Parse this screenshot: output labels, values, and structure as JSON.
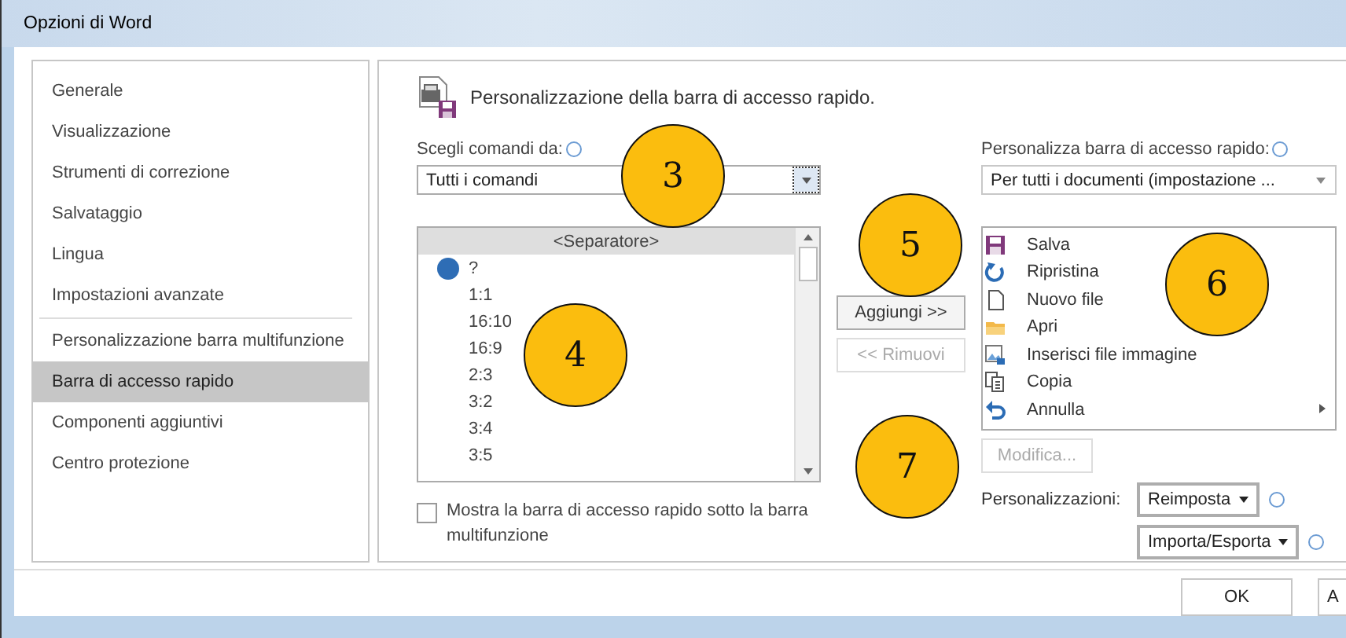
{
  "window": {
    "title": "Opzioni di Word"
  },
  "sidebar": {
    "items": [
      {
        "label": "Generale",
        "selected": false
      },
      {
        "label": "Visualizzazione",
        "selected": false
      },
      {
        "label": "Strumenti di correzione",
        "selected": false
      },
      {
        "label": "Salvataggio",
        "selected": false
      },
      {
        "label": "Lingua",
        "selected": false
      },
      {
        "label": "Impostazioni avanzate",
        "selected": false
      },
      {
        "label": "Personalizzazione barra multifunzione",
        "selected": false
      },
      {
        "label": "Barra di accesso rapido",
        "selected": true
      },
      {
        "label": "Componenti aggiuntivi",
        "selected": false
      },
      {
        "label": "Centro protezione",
        "selected": false
      }
    ]
  },
  "header": {
    "title": "Personalizzazione della barra di accesso rapido."
  },
  "commands_from": {
    "label": "Scegli comandi da:",
    "value": "Tutti i comandi"
  },
  "commands_list": [
    {
      "label": "<Separatore>",
      "selected": true
    },
    {
      "label": "?",
      "selected": false
    },
    {
      "label": "1:1",
      "selected": false
    },
    {
      "label": "16:10",
      "selected": false
    },
    {
      "label": "16:9",
      "selected": false
    },
    {
      "label": "2:3",
      "selected": false
    },
    {
      "label": "3:2",
      "selected": false
    },
    {
      "label": "3:4",
      "selected": false
    },
    {
      "label": "3:5",
      "selected": false
    }
  ],
  "show_below": {
    "label": "Mostra la barra di accesso rapido sotto la barra multifunzione",
    "checked": false
  },
  "add_button": {
    "label": "Aggiungi >>",
    "disabled": false
  },
  "remove_button": {
    "label": "<< Rimuovi",
    "disabled": true
  },
  "customize_for": {
    "label": "Personalizza barra di accesso rapido:",
    "value": "Per tutti i documenti (impostazione ..."
  },
  "toolbar_list": [
    {
      "label": "Salva"
    },
    {
      "label": "Ripristina"
    },
    {
      "label": "Nuovo file"
    },
    {
      "label": "Apri"
    },
    {
      "label": "Inserisci file immagine"
    },
    {
      "label": "Copia"
    },
    {
      "label": "Annulla"
    }
  ],
  "modify_button": {
    "label": "Modifica...",
    "disabled": true
  },
  "customizations": {
    "label": "Personalizzazioni:",
    "reset": "Reimposta",
    "import_export": "Importa/Esporta"
  },
  "footer_buttons": [
    "OK",
    "A"
  ],
  "annotations": [
    {
      "label": "3"
    },
    {
      "label": "4"
    },
    {
      "label": "5"
    },
    {
      "label": "6"
    },
    {
      "label": "7"
    }
  ]
}
